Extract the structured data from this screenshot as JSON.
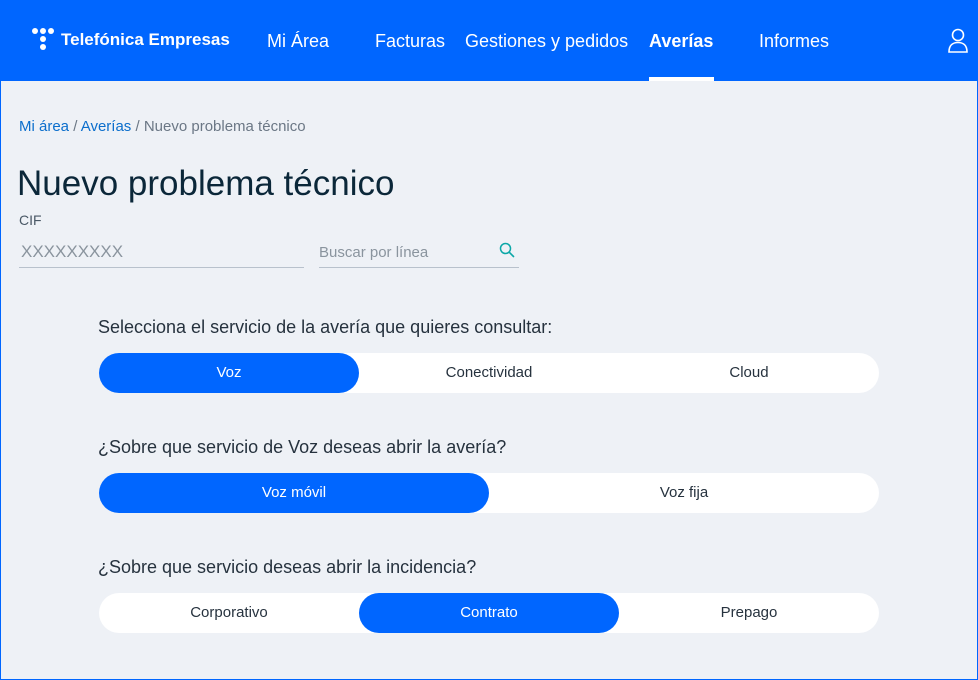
{
  "header": {
    "brand": "Telefónica Empresas",
    "nav": [
      {
        "label": "Mi Área"
      },
      {
        "label": "Facturas"
      },
      {
        "label": "Gestiones y pedidos"
      },
      {
        "label": "Averías"
      },
      {
        "label": "Informes"
      }
    ],
    "active_nav": "Averías"
  },
  "breadcrumb": {
    "items": [
      "Mi área",
      "Averías",
      "Nuevo problema técnico"
    ],
    "separator": "/"
  },
  "page": {
    "title": "Nuevo problema técnico",
    "cif_label": "CIF",
    "cif_placeholder": "XXXXXXXXX",
    "search_placeholder": "Buscar por línea"
  },
  "questions": [
    {
      "label": "Selecciona el servicio de la avería que quieres consultar:",
      "options": [
        "Voz",
        "Conectividad",
        "Cloud"
      ],
      "selected": "Voz"
    },
    {
      "label": "¿Sobre que servicio de Voz deseas abrir la avería?",
      "options": [
        "Voz móvil",
        "Voz fija"
      ],
      "selected": "Voz móvil"
    },
    {
      "label": "¿Sobre que servicio deseas abrir la incidencia?",
      "options": [
        "Corporativo",
        "Contrato",
        "Prepago"
      ],
      "selected": "Contrato"
    }
  ],
  "colors": {
    "brand_blue": "#0066ff",
    "link_blue": "#0b6ecc",
    "background": "#eef1f6",
    "title_text": "#0b2739"
  },
  "icons": {
    "logo": "telefonica-t-logo-icon",
    "user": "user-icon",
    "search": "search-icon"
  }
}
